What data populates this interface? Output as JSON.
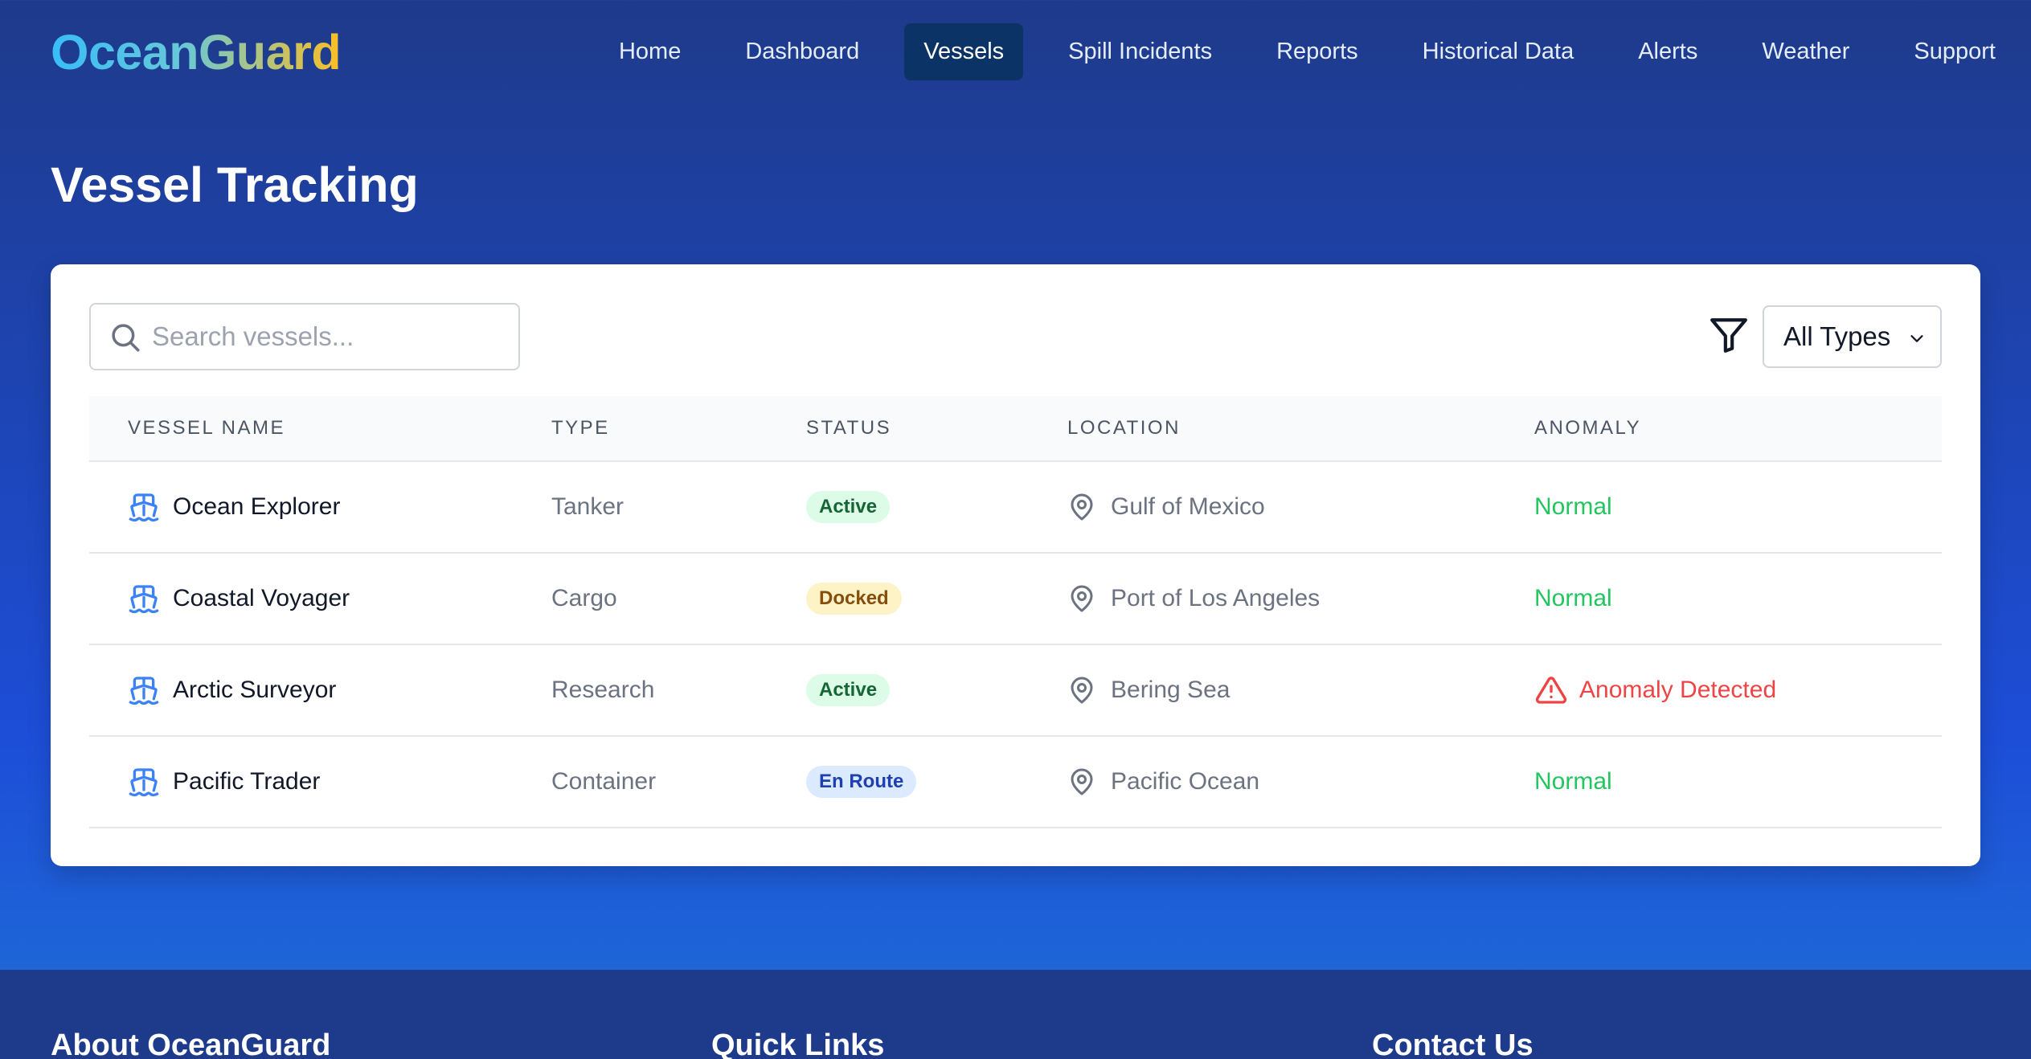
{
  "app": {
    "logo": "OceanGuard"
  },
  "nav": {
    "items": [
      {
        "label": "Home",
        "active": false
      },
      {
        "label": "Dashboard",
        "active": false
      },
      {
        "label": "Vessels",
        "active": true
      },
      {
        "label": "Spill Incidents",
        "active": false
      },
      {
        "label": "Reports",
        "active": false
      },
      {
        "label": "Historical Data",
        "active": false
      },
      {
        "label": "Alerts",
        "active": false
      },
      {
        "label": "Weather",
        "active": false
      },
      {
        "label": "Support",
        "active": false
      }
    ]
  },
  "page": {
    "title": "Vessel Tracking"
  },
  "toolbar": {
    "search_placeholder": "Search vessels...",
    "search_value": "",
    "filter_icon": "filter-icon",
    "type_filter_value": "All Types"
  },
  "table": {
    "columns": [
      "Vessel Name",
      "Type",
      "Status",
      "Location",
      "Anomaly"
    ],
    "rows": [
      {
        "name": "Ocean Explorer",
        "type": "Tanker",
        "status": "Active",
        "location": "Gulf of Mexico",
        "anomaly": "Normal",
        "anomaly_flag": false
      },
      {
        "name": "Coastal Voyager",
        "type": "Cargo",
        "status": "Docked",
        "location": "Port of Los Angeles",
        "anomaly": "Normal",
        "anomaly_flag": false
      },
      {
        "name": "Arctic Surveyor",
        "type": "Research",
        "status": "Active",
        "location": "Bering Sea",
        "anomaly": "Anomaly Detected",
        "anomaly_flag": true
      },
      {
        "name": "Pacific Trader",
        "type": "Container",
        "status": "En Route",
        "location": "Pacific Ocean",
        "anomaly": "Normal",
        "anomaly_flag": false
      }
    ]
  },
  "status_colors": {
    "Active": {
      "bg": "#dcfce7",
      "fg": "#166534"
    },
    "Docked": {
      "bg": "#fef3c7",
      "fg": "#854d0e"
    },
    "En Route": {
      "bg": "#dbeafe",
      "fg": "#1e40af"
    }
  },
  "colors": {
    "accent_active_nav": "#0b3366",
    "normal": "#22c55e",
    "alert": "#ef4444",
    "ship_icon": "#3b82f6"
  },
  "footer": {
    "about_title": "About OceanGuard",
    "links_title": "Quick Links",
    "contact_title": "Contact Us"
  }
}
